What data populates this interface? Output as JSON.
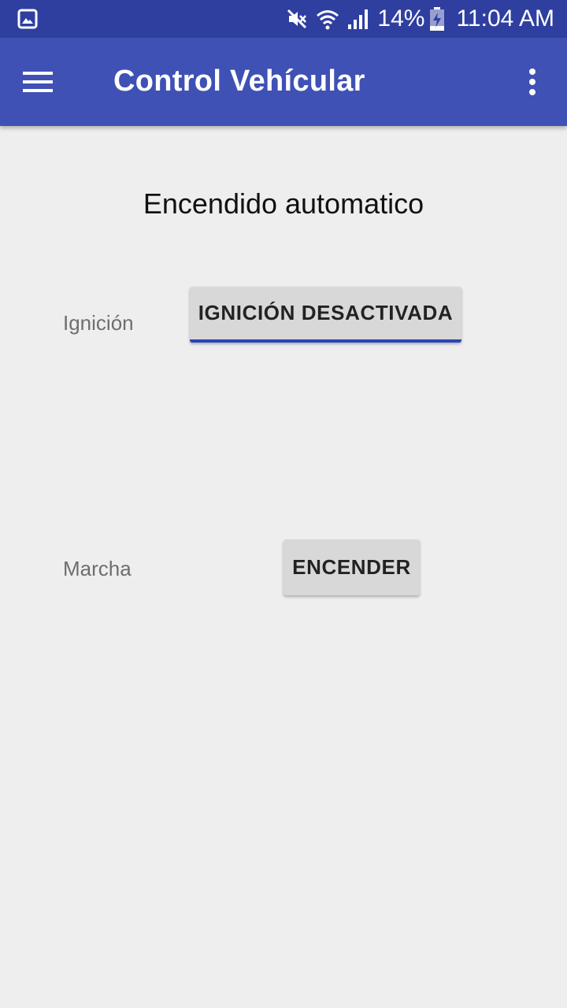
{
  "status_bar": {
    "left_icon": "image-icon",
    "icons": [
      "mute-icon",
      "wifi-icon",
      "signal-icon"
    ],
    "battery_percent": "14%",
    "battery_icon": "battery-charging-icon",
    "time": "11:04 AM"
  },
  "app_bar": {
    "menu_icon": "hamburger-menu-icon",
    "title": "Control Vehícular",
    "overflow_icon": "more-vert-icon"
  },
  "main": {
    "section_title": "Encendido automatico",
    "rows": [
      {
        "label": "Ignición",
        "button": "IGNICIÓN DESACTIVADA",
        "focused": true
      },
      {
        "label": "Marcha",
        "button": "ENCENDER",
        "focused": false
      }
    ]
  },
  "colors": {
    "status_bar": "#2f3fa0",
    "app_bar": "#3f51b5",
    "background": "#eeeeee",
    "button": "#d8d8d8",
    "accent_underline": "#2a45b8"
  }
}
